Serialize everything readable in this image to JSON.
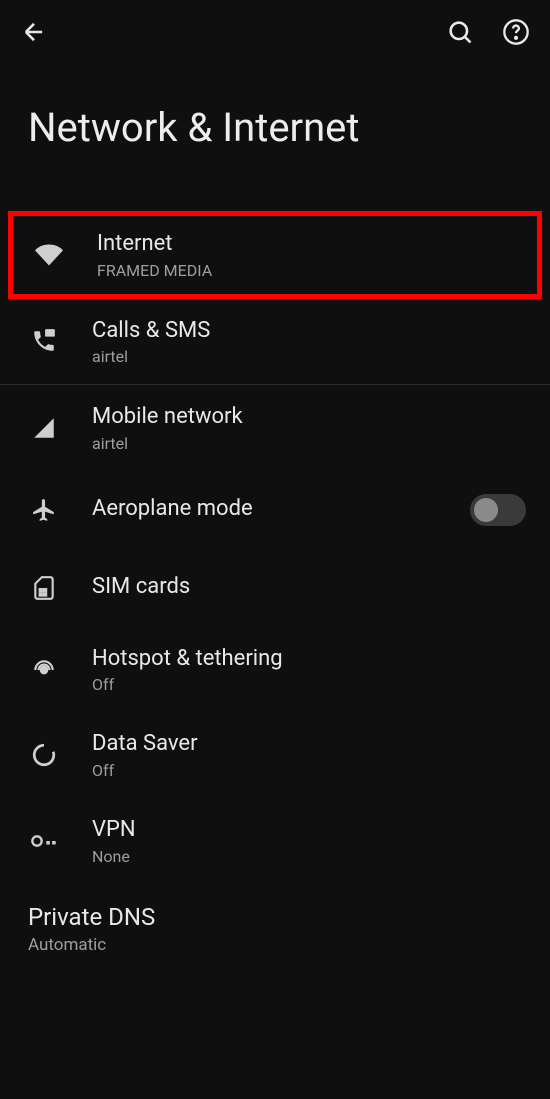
{
  "page": {
    "title": "Network & Internet"
  },
  "items": [
    {
      "title": "Internet",
      "subtitle": "FRAMED MEDIA",
      "highlighted": true
    },
    {
      "title": "Calls & SMS",
      "subtitle": "airtel"
    },
    {
      "title": "Mobile network",
      "subtitle": "airtel"
    },
    {
      "title": "Aeroplane mode",
      "subtitle": null,
      "toggle": false
    },
    {
      "title": "SIM cards",
      "subtitle": null
    },
    {
      "title": "Hotspot & tethering",
      "subtitle": "Off"
    },
    {
      "title": "Data Saver",
      "subtitle": "Off"
    },
    {
      "title": "VPN",
      "subtitle": "None"
    },
    {
      "title": "Private DNS",
      "subtitle": "Automatic"
    }
  ]
}
